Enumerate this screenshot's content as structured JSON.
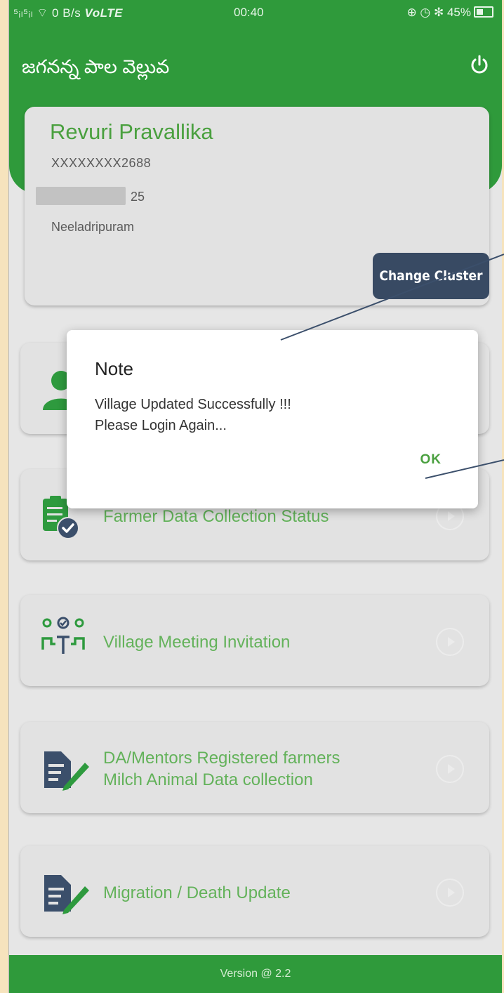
{
  "status_bar": {
    "signal": "⁵ᵢₗ⁵ᵢₗ ⌔ 0 B/s",
    "network": "VoLTE",
    "time": "00:40",
    "right_icons": "⊕ ◷ ✻ 45%"
  },
  "header": {
    "title": "జగనన్న పాల వెల్లువ"
  },
  "profile": {
    "name": "Revuri Pravallika",
    "id_masked": "XXXXXXXX2688",
    "number_suffix": "25",
    "village": "Neeladripuram",
    "change_cluster_label": "Change Cluster"
  },
  "menu": {
    "items": [
      {
        "label": ""
      },
      {
        "label": "Farmer Data Collection Status"
      },
      {
        "label": "Village Meeting Invitation"
      },
      {
        "label": "DA/Mentors Registered farmers\nMilch Animal Data collection"
      },
      {
        "label": "Migration / Death Update"
      }
    ]
  },
  "footer": {
    "version": "Version @ 2.2"
  },
  "dialog": {
    "title": "Note",
    "line1": "Village Updated Successfully !!!",
    "line2": "Please Login Again...",
    "ok_label": "OK"
  },
  "colors": {
    "primary_green": "#2f9a3b",
    "label_green": "#63b25a",
    "button_navy": "#384a63",
    "card_bg": "#e2e2e2"
  },
  "icons": [
    "power-icon",
    "user-icon",
    "clipboard-check-icon",
    "meeting-people-icon",
    "edit-document-icon",
    "play-circle-icon"
  ]
}
